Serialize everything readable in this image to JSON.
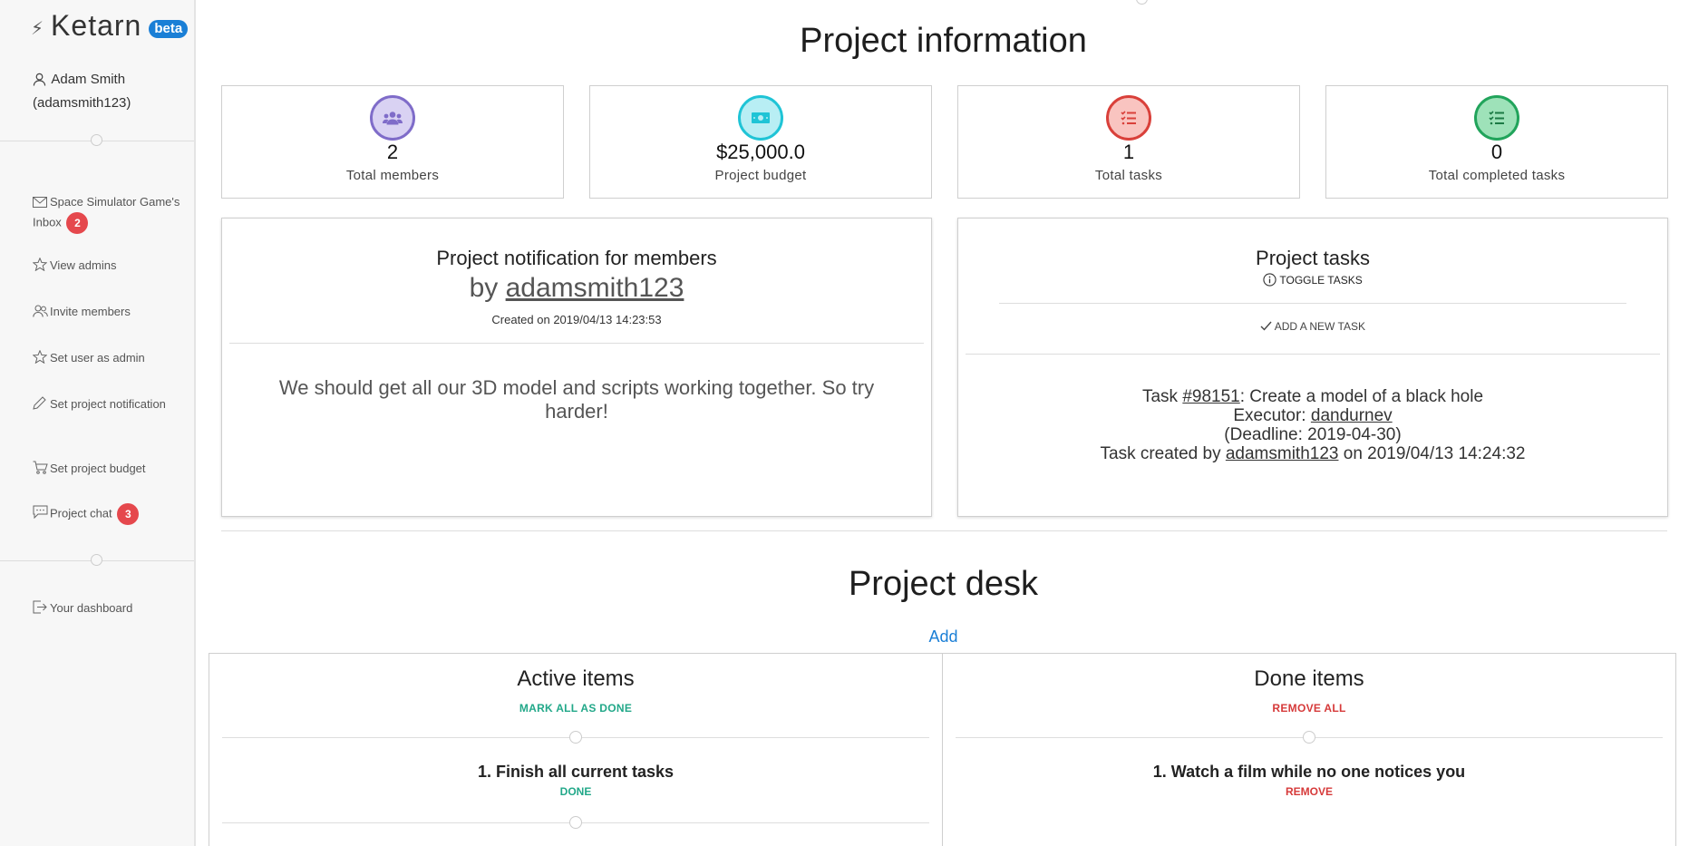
{
  "brand": {
    "name": "Ketarn",
    "badge": "beta",
    "badge_color": "#1a7fd6"
  },
  "user": {
    "name": "Adam Smith",
    "handle": "(adamsmith123)"
  },
  "sidebar": {
    "items": [
      {
        "label": "Space Simulator Game's Inbox",
        "icon": "envelope-icon",
        "badge": "2"
      },
      {
        "label": "View admins",
        "icon": "star-icon"
      },
      {
        "label": "Invite members",
        "icon": "users-icon"
      },
      {
        "label": "Set user as admin",
        "icon": "star-icon"
      },
      {
        "label": "Set project notification",
        "icon": "pencil-icon"
      },
      {
        "label": "Set project budget",
        "icon": "cart-icon"
      },
      {
        "label": "Project chat",
        "icon": "chat-icon",
        "badge": "3"
      },
      {
        "label": "Your dashboard",
        "icon": "sign-out-icon"
      }
    ]
  },
  "project_info": {
    "title": "Project information",
    "stats": [
      {
        "value": "2",
        "label": "Total members",
        "icon": "users-icon",
        "color": "#7f6cc9",
        "fill": "#d9d2f3"
      },
      {
        "value": "$25,000.0",
        "label": "Project budget",
        "icon": "money-icon",
        "color": "#1fc4d6",
        "fill": "#b8eef4"
      },
      {
        "value": "1",
        "label": "Total tasks",
        "icon": "task-list-icon",
        "color": "#d9403a",
        "fill": "#f9c4c0"
      },
      {
        "value": "0",
        "label": "Total completed tasks",
        "icon": "task-list-icon",
        "color": "#21a45b",
        "fill": "#9ee2b9"
      }
    ]
  },
  "notification": {
    "title": "Project notification for members",
    "by_prefix": "by",
    "by_user": "adamsmith123",
    "created": "Created on 2019/04/13 14:23:53",
    "message": "We should get all our 3D model and scripts working together. So try harder!"
  },
  "tasks": {
    "title": "Project tasks",
    "toggle": "TOGGLE TASKS",
    "add": "ADD A NEW TASK",
    "task": {
      "prefix": "Task ",
      "id": "#98151",
      "name": ": Create a model of a black hole",
      "executor_label": "Executor: ",
      "executor": "dandurnev",
      "deadline": "(Deadline: 2019-04-30)",
      "created_prefix": "Task created by ",
      "created_by": "adamsmith123",
      "created_suffix": " on 2019/04/13 14:24:32"
    }
  },
  "desk": {
    "title": "Project desk",
    "add": "Add",
    "active": {
      "title": "Active items",
      "action": "MARK ALL AS DONE",
      "color": "#22a889",
      "item": "1. Finish all current tasks",
      "item_action": "DONE"
    },
    "done": {
      "title": "Done items",
      "action": "REMOVE ALL",
      "color": "#d63a3a",
      "item": "1. Watch a film while no one notices you",
      "item_action": "REMOVE"
    }
  }
}
